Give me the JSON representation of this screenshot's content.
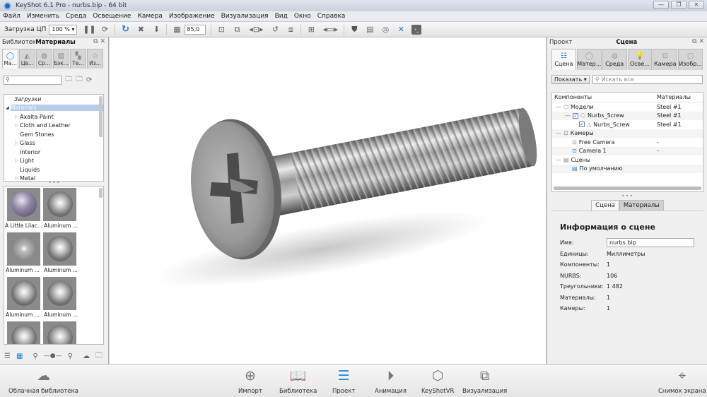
{
  "window": {
    "title": "KeyShot 6.1 Pro  - nurbs.bip  - 64 bit",
    "controls": [
      "minimize",
      "restore",
      "close"
    ]
  },
  "menu": [
    "Файл",
    "Изменить",
    "Среда",
    "Освещение",
    "Камера",
    "Изображение",
    "Визуализация",
    "Вид",
    "Окно",
    "Справка"
  ],
  "toolbar": {
    "cpu_label": "Загрузка ЦП",
    "cpu_value": "100 %",
    "fov_value": "85,0",
    "icons": [
      "pause-icon",
      "refresh-icon",
      "redo-icon",
      "fit-icon",
      "drop-icon",
      "grid-icon",
      "screenshot-add-icon",
      "camera-add-icon",
      "camera-switch-icon",
      "rotate-icon",
      "lock-icon",
      "environment-add-icon",
      "environment-switch-icon",
      "shield-icon",
      "layout-icon",
      "geometry-icon",
      "network-icon",
      "console-icon"
    ]
  },
  "library": {
    "header_prefix": "Библиотека",
    "header_title": "Материалы",
    "tabs": [
      {
        "label": "Ма...",
        "icon": "material-icon",
        "active": true
      },
      {
        "label": "Цв...",
        "icon": "color-icon"
      },
      {
        "label": "Ср...",
        "icon": "environment-icon"
      },
      {
        "label": "Бэк...",
        "icon": "backplate-icon"
      },
      {
        "label": "Те...",
        "icon": "texture-icon"
      },
      {
        "label": "Из...",
        "icon": "favorites-icon"
      }
    ],
    "search_placeholder": "",
    "tree": [
      {
        "label": "Загрузки",
        "italic": true,
        "level": 0
      },
      {
        "label": "Materials",
        "selected": true,
        "expanded": true,
        "level": 0
      },
      {
        "label": "Axalta Paint",
        "expandable": true,
        "level": 1
      },
      {
        "label": "Cloth and Leather",
        "expandable": true,
        "level": 1
      },
      {
        "label": "Gem Stones",
        "level": 1
      },
      {
        "label": "Glass",
        "expandable": true,
        "level": 1
      },
      {
        "label": "Interior",
        "level": 1
      },
      {
        "label": "Light",
        "expandable": true,
        "level": 1
      },
      {
        "label": "Liquids",
        "level": 1
      },
      {
        "label": "Metal",
        "expandable": true,
        "level": 1
      }
    ],
    "thumbnails": [
      {
        "label": "A Little Lilac..."
      },
      {
        "label": "Aluminum ..."
      },
      {
        "label": "Aluminum ..."
      },
      {
        "label": "Aluminum ..."
      },
      {
        "label": "Aluminum ..."
      },
      {
        "label": "Aluminum ..."
      },
      {
        "label": ""
      },
      {
        "label": ""
      }
    ]
  },
  "project": {
    "header_prefix": "Проект",
    "header_title": "Сцена",
    "tabs": [
      {
        "label": "Сцена",
        "icon": "scene-icon",
        "active": true
      },
      {
        "label": "Матер...",
        "icon": "material-icon"
      },
      {
        "label": "Среда",
        "icon": "environment-icon"
      },
      {
        "label": "Осве...",
        "icon": "lighting-icon"
      },
      {
        "label": "Камера",
        "icon": "camera-icon"
      },
      {
        "label": "Изобр...",
        "icon": "image-icon"
      }
    ],
    "show_button": "Показать",
    "search_placeholder": "Искать все",
    "columns": [
      "Компоненты",
      "Материалы"
    ],
    "rows": [
      {
        "label": "Модели",
        "material": "Steel #1",
        "level": 0,
        "icon": "model-icon"
      },
      {
        "label": "Nurbs_Screw",
        "material": "Steel #1",
        "level": 1,
        "checked": true,
        "icon": "model-icon"
      },
      {
        "label": "Nurbs_Screw",
        "material": "Steel #1",
        "level": 2,
        "checked": true,
        "icon": "part-icon"
      },
      {
        "label": "Камеры",
        "material": "",
        "level": 0,
        "icon": "camera-icon"
      },
      {
        "label": "Free Camera",
        "material": "-",
        "level": 1,
        "icon": "camera-icon"
      },
      {
        "label": "Camera 1",
        "material": "-",
        "level": 1,
        "icon": "camera-icon"
      },
      {
        "label": "Сцены",
        "material": "",
        "level": 0,
        "icon": "scene-set-icon"
      },
      {
        "label": "По умолчанию",
        "material": "",
        "level": 1,
        "icon": "scene-set-icon"
      }
    ],
    "subtabs": [
      {
        "label": "Сцена",
        "active": true
      },
      {
        "label": "Материалы"
      }
    ],
    "info": {
      "title": "Информация о сцене",
      "name_label": "Имя:",
      "name_value": "nurbs.bip",
      "fields": [
        {
          "k": "Единицы:",
          "v": "Миллиметры"
        },
        {
          "k": "Компоненты:",
          "v": "1"
        },
        {
          "k": "NURBS:",
          "v": "106"
        },
        {
          "k": "Треугольники:",
          "v": "1 482"
        },
        {
          "k": "Материалы:",
          "v": "1"
        },
        {
          "k": "Камеры:",
          "v": "1"
        }
      ]
    }
  },
  "bottombar": [
    {
      "label": "Облачная библиотека",
      "icon": "cloud-library-icon"
    },
    {
      "label": "Импорт",
      "icon": "import-icon"
    },
    {
      "label": "Библиотека",
      "icon": "library-icon",
      "active": true
    },
    {
      "label": "Проект",
      "icon": "project-icon",
      "active": true
    },
    {
      "label": "Анимация",
      "icon": "animation-icon"
    },
    {
      "label": "KeyShotVR",
      "icon": "keyshotvr-icon"
    },
    {
      "label": "Визуализация",
      "icon": "render-icon"
    },
    {
      "label": "Снимок экрана",
      "icon": "screenshot-icon"
    }
  ],
  "colors": {
    "accent": "#2b8ad8",
    "selection": "#b6cce8"
  }
}
